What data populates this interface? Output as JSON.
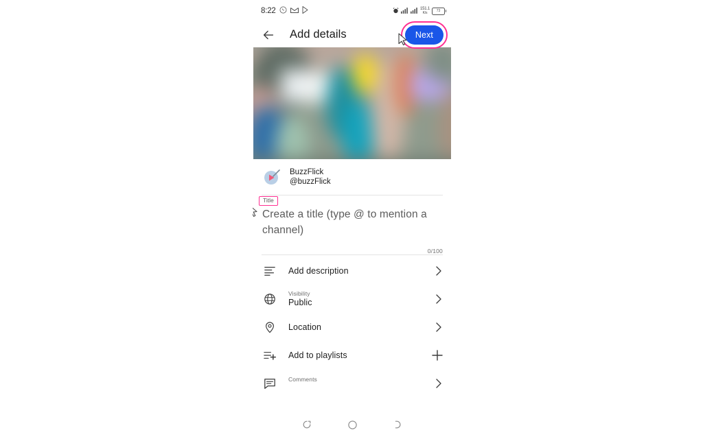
{
  "statusbar": {
    "time": "8:22",
    "left_icons": [
      "whatsapp-icon",
      "gmail-icon",
      "play-store-icon"
    ],
    "alarm_icon": "alarm-icon",
    "net_speed_value": "151.1",
    "net_speed_unit": "K/s",
    "battery_level": "73",
    "signal_icons": [
      "signal-bars-sim1-icon",
      "signal-bars-sim2-icon"
    ]
  },
  "appbar": {
    "back_icon": "back-arrow-icon",
    "title": "Add details",
    "next_label": "Next"
  },
  "annotations": {
    "next_highlight_color": "#ff2f92",
    "title_highlight_color": "#ff2f92",
    "cursor_icon": "mouse-cursor-icon"
  },
  "video": {
    "thumbnail_alt": "blurred-street-crowd-thumbnail"
  },
  "channel": {
    "avatar_icon": "buzzflick-play-avatar",
    "name": "BuzzFlick",
    "handle": "@buzzFlick"
  },
  "title_field": {
    "chip_label": "Title",
    "placeholder": "Create a title (type @ to mention a channel)",
    "char_count": "0/100"
  },
  "options": [
    {
      "icon": "description-lines-icon",
      "label": "Add description",
      "sublabel": "",
      "value": "",
      "trailing": "chevron-right-icon"
    },
    {
      "icon": "globe-icon",
      "label": "",
      "sublabel": "Visibility",
      "value": "Public",
      "trailing": "chevron-right-icon"
    },
    {
      "icon": "location-pin-icon",
      "label": "Location",
      "sublabel": "",
      "value": "",
      "trailing": "chevron-right-icon"
    },
    {
      "icon": "playlist-add-icon",
      "label": "Add to playlists",
      "sublabel": "",
      "value": "",
      "trailing": "plus-icon"
    },
    {
      "icon": "comment-icon",
      "label": "",
      "sublabel": "Comments",
      "value": "",
      "trailing": "chevron-right-icon"
    }
  ],
  "navbar": {
    "recent_icon": "recents-icon",
    "home_icon": "home-circle-icon",
    "back_icon": "back-nav-icon"
  },
  "colors": {
    "accent_blue": "#1a56e8",
    "annotation_pink": "#ff2f92",
    "text_primary": "#1c1c1c",
    "text_secondary": "#6e6e6e"
  }
}
